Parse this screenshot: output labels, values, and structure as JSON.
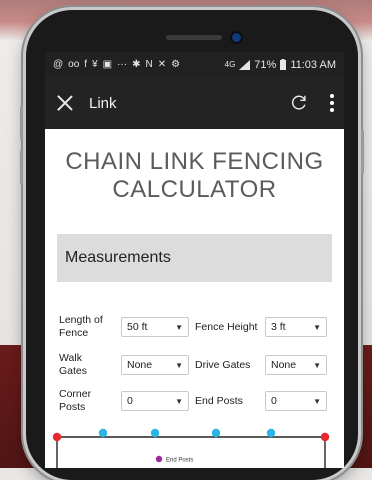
{
  "status_bar": {
    "left_icons": [
      "@",
      "oo",
      "f",
      "¥",
      "▣",
      "···",
      "✱",
      "N",
      "✕",
      "⚙"
    ],
    "signal": "4G",
    "battery": "71%",
    "time": "11:03 AM"
  },
  "app_bar": {
    "title": "Link",
    "close_icon": "close-icon",
    "reload_icon": "reload-icon",
    "menu_icon": "more-vert-icon"
  },
  "page": {
    "title": "CHAIN LINK FENCING CALCULATOR"
  },
  "measurements": {
    "heading": "Measurements",
    "fields": [
      {
        "label": "Length of Fence",
        "value": "50 ft"
      },
      {
        "label": "Fence Height",
        "value": "3 ft"
      },
      {
        "label": "Walk Gates",
        "value": "None"
      },
      {
        "label": "Drive Gates",
        "value": "None"
      },
      {
        "label": "Corner Posts",
        "value": "0"
      },
      {
        "label": "End Posts",
        "value": "0"
      }
    ]
  },
  "diagram": {
    "legend": "End Posts",
    "colors": {
      "end_post": "#e8262b",
      "line_post": "#29b5e6",
      "legend_dot": "#9b2b9b"
    }
  }
}
